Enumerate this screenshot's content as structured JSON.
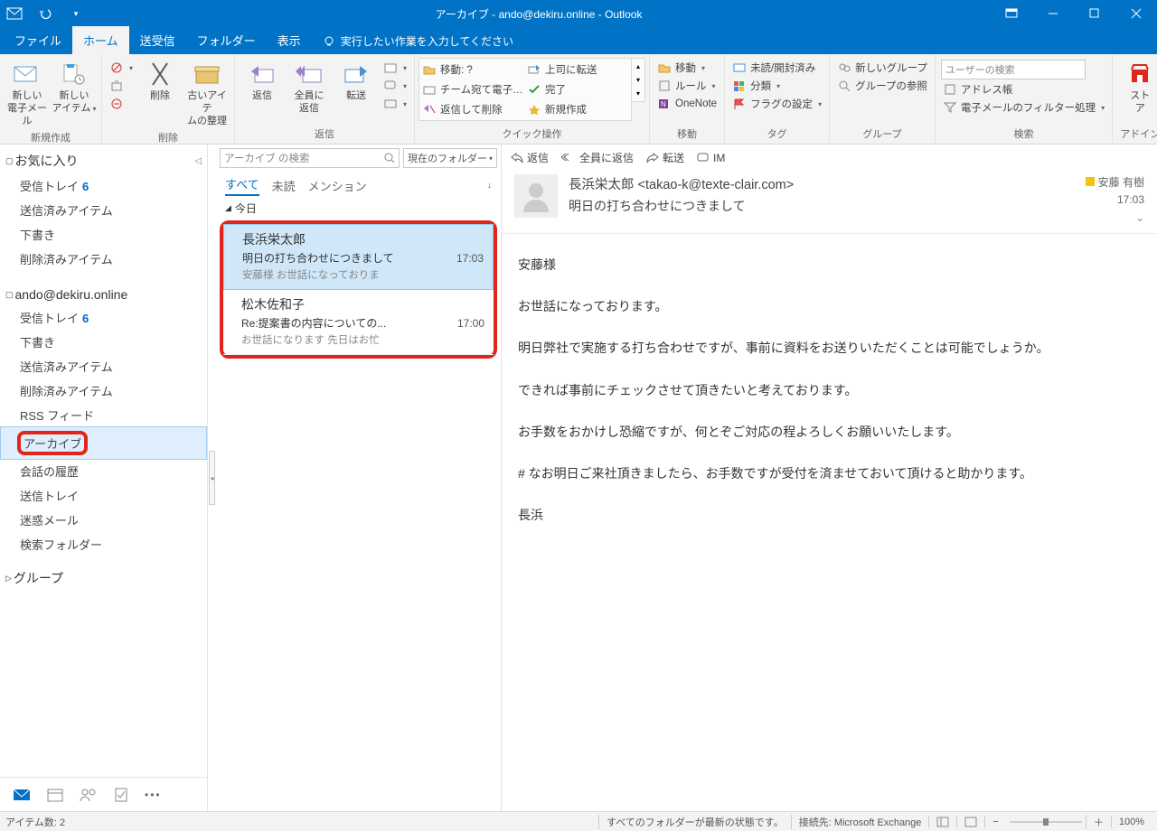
{
  "title": "アーカイブ - ando@dekiru.online - Outlook",
  "menu": {
    "file": "ファイル",
    "home": "ホーム",
    "sendrecv": "送受信",
    "folder": "フォルダー",
    "view": "表示",
    "tellme": "実行したい作業を入力してください"
  },
  "ribbon": {
    "new": {
      "mail": "新しい\n電子メール",
      "item": "新しい\nアイテム",
      "label": "新規作成"
    },
    "delete": {
      "del": "削除",
      "clean": "古いアイテ\nムの整理",
      "label": "削除"
    },
    "reply": {
      "reply": "返信",
      "replyall": "全員に\n返信",
      "forward": "転送",
      "label": "返信"
    },
    "quick": {
      "move": "移動: ?",
      "team": "チーム宛て電子…",
      "replydel": "返信して削除",
      "boss": "上司に転送",
      "done": "完了",
      "create": "新規作成",
      "label": "クイック操作"
    },
    "movegrp": {
      "move": "移動",
      "rule": "ルール",
      "onenote": "OneNote",
      "label": "移動"
    },
    "tag": {
      "unread": "未読/開封済み",
      "cat": "分類",
      "flag": "フラグの設定",
      "label": "タグ"
    },
    "group": {
      "newg": "新しいグループ",
      "browse": "グループの参照",
      "label": "グループ"
    },
    "search": {
      "placeholder": "ユーザーの検索",
      "addr": "アドレス帳",
      "filter": "電子メールのフィルター処理",
      "label": "検索"
    },
    "addin": {
      "store": "スト\nア",
      "label": "アドイン"
    }
  },
  "folders": {
    "fav": "お気に入り",
    "favItems": [
      {
        "label": "受信トレイ",
        "count": "6"
      },
      {
        "label": "送信済みアイテム"
      },
      {
        "label": "下書き"
      },
      {
        "label": "削除済みアイテム"
      }
    ],
    "account": "ando@dekiru.online",
    "acctItems": [
      {
        "label": "受信トレイ",
        "count": "6"
      },
      {
        "label": "下書き"
      },
      {
        "label": "送信済みアイテム"
      },
      {
        "label": "削除済みアイテム"
      },
      {
        "label": "RSS フィード"
      },
      {
        "label": "アーカイブ",
        "sel": true,
        "highlight": true
      },
      {
        "label": "会話の履歴"
      },
      {
        "label": "送信トレイ"
      },
      {
        "label": "迷惑メール"
      },
      {
        "label": "検索フォルダー"
      }
    ],
    "group": "グループ"
  },
  "list": {
    "searchPlaceholder": "アーカイブ の検索",
    "scope": "現在のフォルダー",
    "filters": {
      "all": "すべて",
      "unread": "未読",
      "mention": "メンション"
    },
    "date": "今日",
    "items": [
      {
        "from": "長浜栄太郎",
        "subject": "明日の打ち合わせにつきまして",
        "preview": "安藤様  お世話になっておりま",
        "time": "17:03",
        "sel": true
      },
      {
        "from": "松木佐和子",
        "subject": "Re:提案書の内容についての...",
        "preview": "お世話になります  先日はお忙",
        "time": "17:00"
      }
    ]
  },
  "reading": {
    "actions": {
      "reply": "返信",
      "replyall": "全員に返信",
      "forward": "転送",
      "im": "IM"
    },
    "from": "長浜栄太郎 <takao-k@texte-clair.com>",
    "subject": "明日の打ち合わせにつきまして",
    "category": "安藤 有樹",
    "time": "17:03",
    "body": [
      "安藤様",
      "お世話になっております。",
      "明日弊社で実施する打ち合わせですが、事前に資料をお送りいただくことは可能でしょうか。",
      "できれば事前にチェックさせて頂きたいと考えております。",
      "お手数をおかけし恐縮ですが、何とぞご対応の程よろしくお願いいたします。",
      "#  なお明日ご来社頂きましたら、お手数ですが受付を済ませておいて頂けると助かります。",
      "長浜"
    ]
  },
  "status": {
    "count": "アイテム数: 2",
    "sync": "すべてのフォルダーが最新の状態です。",
    "conn": "接続先: Microsoft Exchange",
    "zoom": "100%"
  }
}
